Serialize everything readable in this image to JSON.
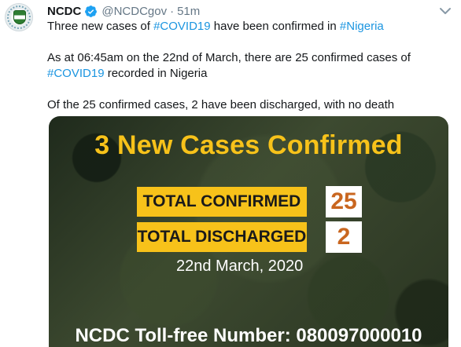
{
  "tweet": {
    "author_name": "NCDC",
    "handle": "@NCDCgov",
    "separator": "·",
    "time": "51m",
    "line1_pre": "Three new cases of ",
    "line1_tag1": "#COVID19",
    "line1_mid": " have been confirmed in ",
    "line1_tag2": "#Nigeria",
    "line2": "As at 06:45am on the 22nd of March, there are 25 confirmed cases of",
    "line3_tag": "#COVID19",
    "line3_post": " recorded in Nigeria",
    "line4": "Of the 25 confirmed cases, 2 have been discharged, with no death"
  },
  "media": {
    "title": "3 New Cases Confirmed",
    "total_confirmed_label": "TOTAL CONFIRMED",
    "total_confirmed_value": "25",
    "total_discharged_label": "TOTAL DISCHARGED",
    "total_discharged_value": "2",
    "date": "22nd March, 2020",
    "tollfree": "NCDC Toll-free Number: 080097000010"
  },
  "colors": {
    "link": "#1b95e0",
    "verified_badge": "#1da1f2",
    "banner_yellow": "#f7c21a",
    "value_orange": "#c9661f"
  },
  "icons": {
    "avatar": "ncdc-logo-avatar",
    "verified": "verified-badge-icon",
    "menu": "chevron-down-icon"
  }
}
